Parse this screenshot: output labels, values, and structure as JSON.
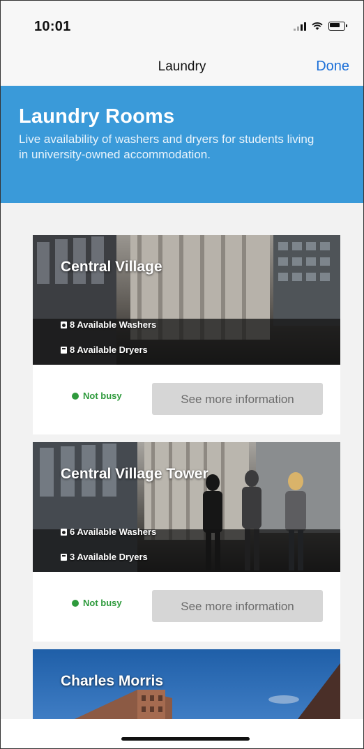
{
  "status_bar": {
    "time": "10:01"
  },
  "nav": {
    "title": "Laundry",
    "done_label": "Done"
  },
  "header": {
    "title": "Laundry Rooms",
    "description": "Live availability of washers and dryers for students living in university-owned accommodation."
  },
  "rooms": [
    {
      "name": "Central Village",
      "washers": "8 Available Washers",
      "dryers": "8 Available Dryers",
      "status": "Not busy",
      "button_label": "See more information"
    },
    {
      "name": "Central Village Tower",
      "washers": "6 Available Washers",
      "dryers": "3 Available Dryers",
      "status": "Not busy",
      "button_label": "See more information"
    },
    {
      "name": "Charles Morris"
    }
  ],
  "colors": {
    "header_blue": "#3a9ad9",
    "done_blue": "#1a6fd8",
    "status_green": "#2e9a3c",
    "button_gray": "#d6d6d6"
  }
}
